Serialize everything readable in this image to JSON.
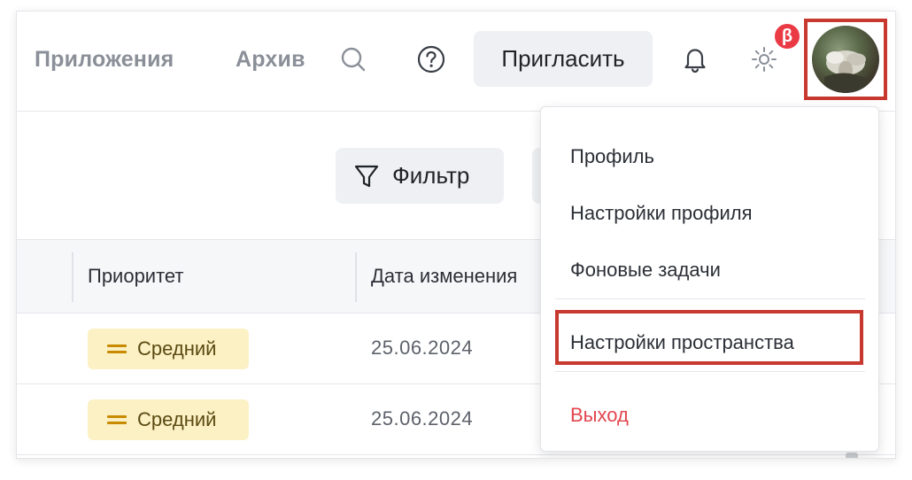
{
  "topbar": {
    "nav": [
      {
        "label": "Приложения"
      },
      {
        "label": "Архив"
      }
    ],
    "invite_label": "Пригласить",
    "beta_badge": "β"
  },
  "toolbar": {
    "filter_label": "Фильтр"
  },
  "table": {
    "columns": [
      "Приоритет",
      "Дата изменения"
    ],
    "rows": [
      {
        "priority": "Средний",
        "date": "25.06.2024"
      },
      {
        "priority": "Средний",
        "date": "25.06.2024"
      }
    ]
  },
  "user_menu": {
    "items": [
      {
        "label": "Профиль"
      },
      {
        "label": "Настройки профиля"
      },
      {
        "label": "Фоновые задачи"
      },
      {
        "label": "Настройки пространства"
      },
      {
        "label": "Выход"
      }
    ]
  },
  "colors": {
    "accent_highlight": "#c7382f",
    "priority_bg": "#fcf1c4",
    "logout": "#e2464f"
  }
}
